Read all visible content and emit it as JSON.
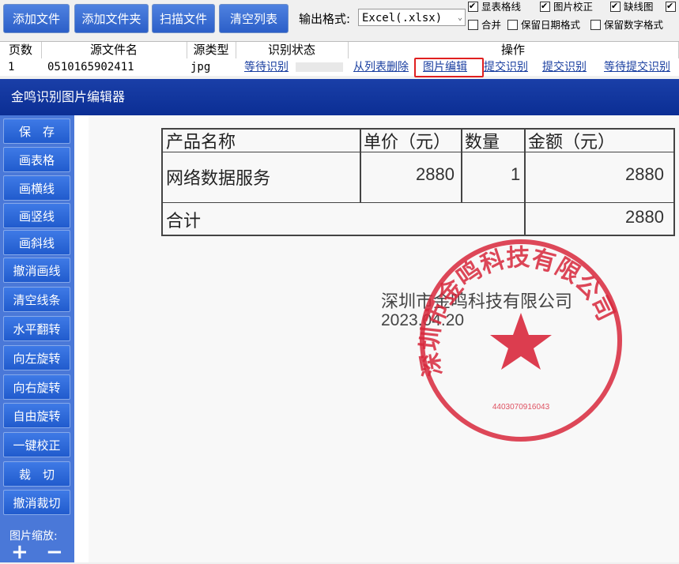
{
  "toolbar": {
    "add_file": "添加文件",
    "add_folder": "添加文件夹",
    "scan_file": "扫描文件",
    "clear_list": "清空列表",
    "format_label": "输出格式:",
    "format_value": "Excel(.xlsx)"
  },
  "options": {
    "show_grid": {
      "label": "显表格线",
      "checked": true
    },
    "image_correct": {
      "label": "图片校正",
      "checked": true
    },
    "missing_line": {
      "label": "缺线图",
      "checked": true
    },
    "extra_checked": {
      "label": "",
      "checked": true
    },
    "merge": {
      "label": "合并",
      "checked": false
    },
    "keep_date": {
      "label": "保留日期格式",
      "checked": false
    },
    "keep_number": {
      "label": "保留数字格式",
      "checked": false
    }
  },
  "grid": {
    "headers": [
      "页数",
      "源文件名",
      "源类型",
      "识别状态",
      "操作"
    ],
    "row": {
      "page": "1",
      "filename": "0510165902411",
      "type": "jpg",
      "status": "等待识别",
      "actions": [
        "从列表删除",
        "图片编辑",
        "提交识别",
        "提交识别",
        "等待提交识别"
      ]
    }
  },
  "editor": {
    "title": "金鸣识别图片编辑器",
    "buttons": [
      "保　存",
      "画表格",
      "画横线",
      "画竖线",
      "画斜线",
      "撤消画线",
      "清空线条",
      "水平翻转",
      "向左旋转",
      "向右旋转",
      "自由旋转",
      "一键校正",
      "裁　切",
      "撤消裁切"
    ],
    "zoom_label": "图片缩放:",
    "zoom_in": "+",
    "zoom_out": "−"
  },
  "document": {
    "headers": [
      "产品名称",
      "单价（元）",
      "数量",
      "金额（元）"
    ],
    "item": {
      "name": "网络数据服务",
      "price": "2880",
      "qty": "1",
      "amount": "2880"
    },
    "total_label": "合计",
    "total_value": "2880",
    "company": "深圳市金鸣科技有限公司",
    "date": "2023.04.20",
    "seal_text": "深圳市金鸣科技有限公司",
    "seal_number": "4403070916043",
    "seal_color": "#d8283c"
  }
}
